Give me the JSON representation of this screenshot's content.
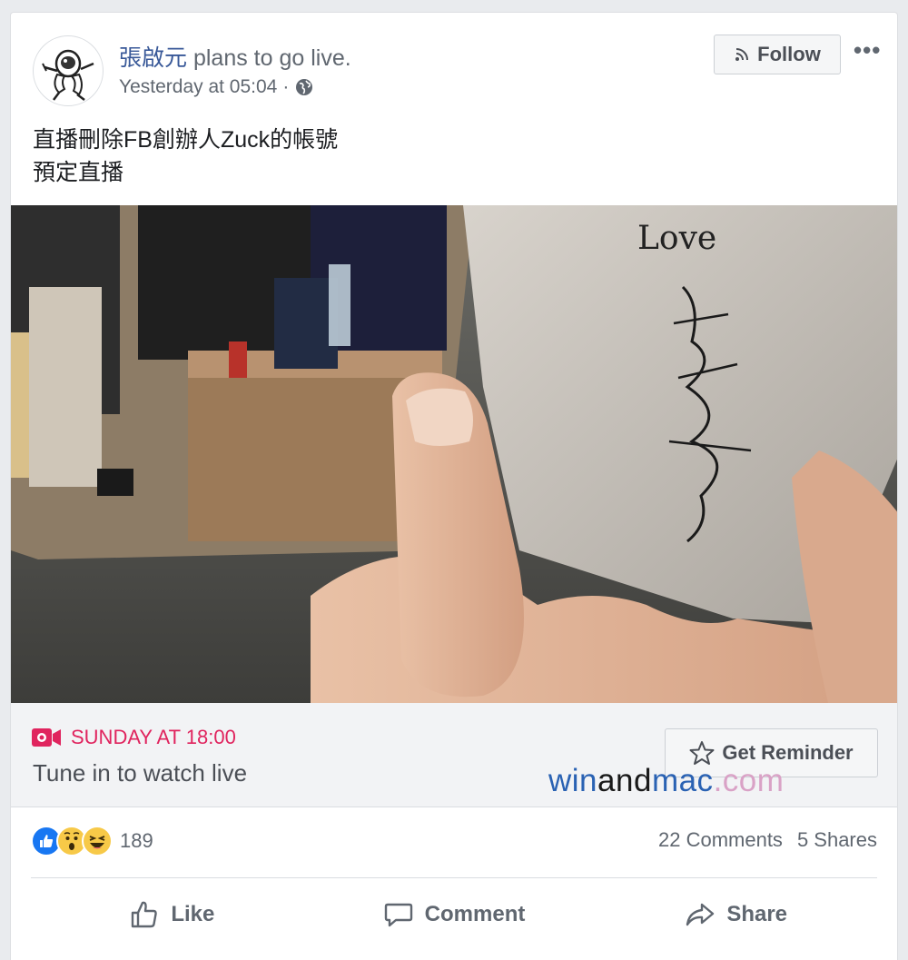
{
  "post": {
    "author": "張啟元",
    "action": " plans to go live.",
    "timestamp": "Yesterday at 05:04",
    "separator": "·",
    "privacy_icon": "globe-icon",
    "follow_label": "Follow",
    "more_label": "•••",
    "text_line1": "直播刪除FB創辦人Zuck的帳號",
    "text_line2": "預定直播"
  },
  "event": {
    "date": "SUNDAY AT 18:00",
    "subtitle": "Tune in to watch live",
    "reminder_label": "Get Reminder",
    "accent": "#e0245e"
  },
  "watermark": {
    "part1": "win",
    "part2": "and",
    "part3": "mac",
    "part4": ".com"
  },
  "photo": {
    "card_text": "Love"
  },
  "stats": {
    "reaction_icons": [
      "like-icon",
      "wow-icon",
      "haha-icon"
    ],
    "reaction_count": "189",
    "comments": "22 Comments",
    "shares": "5 Shares"
  },
  "actions": {
    "like": "Like",
    "comment": "Comment",
    "share": "Share"
  },
  "colors": {
    "link": "#385898",
    "muted": "#606770",
    "like_blue": "#1877f2",
    "emoji_yellow": "#f7c948"
  }
}
